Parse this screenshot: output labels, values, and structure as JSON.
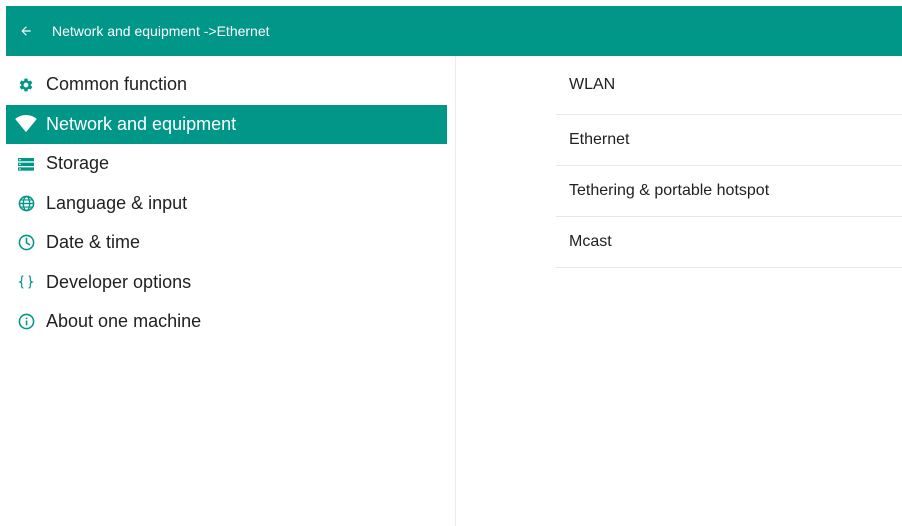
{
  "appbar": {
    "back_icon": "arrow-left-icon",
    "title": "Network and equipment ->Ethernet"
  },
  "colors": {
    "accent": "#009688",
    "text": "#212121",
    "on_accent": "#ffffff",
    "divider": "#e6e6e6"
  },
  "sidebar": {
    "items": [
      {
        "label": "Common function",
        "icon": "gear-icon",
        "active": false
      },
      {
        "label": "Network and equipment",
        "icon": "wifi-icon",
        "active": true
      },
      {
        "label": "Storage",
        "icon": "storage-icon",
        "active": false
      },
      {
        "label": "Language & input",
        "icon": "globe-icon",
        "active": false
      },
      {
        "label": "Date & time",
        "icon": "clock-icon",
        "active": false
      },
      {
        "label": "Developer options",
        "icon": "braces-icon",
        "active": false
      },
      {
        "label": "About one machine",
        "icon": "info-icon",
        "active": false
      }
    ]
  },
  "detail": {
    "items": [
      {
        "label": "WLAN"
      },
      {
        "label": "Ethernet"
      },
      {
        "label": "Tethering & portable hotspot"
      },
      {
        "label": "Mcast"
      }
    ]
  }
}
